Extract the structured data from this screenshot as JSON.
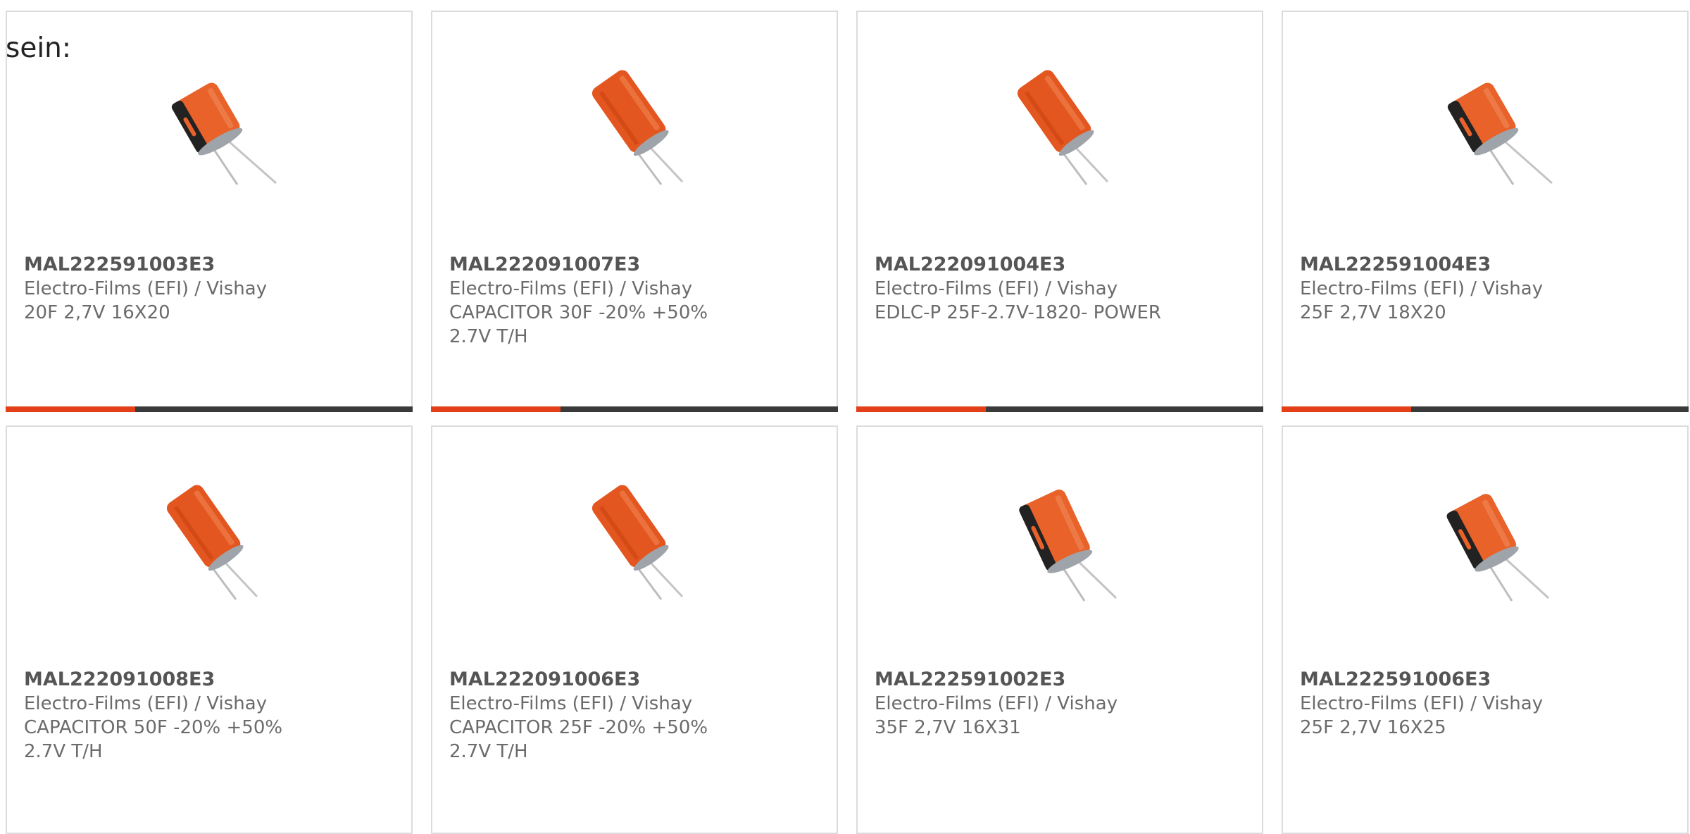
{
  "intro_text": "sein:",
  "colors": {
    "accent": "#e3401a",
    "bar_dark": "#3a3a3a",
    "capacitor_orange": "#e8622a"
  },
  "products": [
    {
      "part_number": "MAL222591003E3",
      "manufacturer": "Electro-Films (EFI) / Vishay",
      "description": "20F 2,7V 16X20",
      "image_icon": "capacitor-image"
    },
    {
      "part_number": "MAL222091007E3",
      "manufacturer": "Electro-Films (EFI) / Vishay",
      "description": "CAPACITOR 30F -20% +50%\n2.7V T/H",
      "image_icon": "capacitor-image"
    },
    {
      "part_number": "MAL222091004E3",
      "manufacturer": "Electro-Films (EFI) / Vishay",
      "description": "EDLC-P 25F-2.7V-1820- POWER",
      "image_icon": "capacitor-image"
    },
    {
      "part_number": "MAL222591004E3",
      "manufacturer": "Electro-Films (EFI) / Vishay",
      "description": "25F 2,7V 18X20",
      "image_icon": "capacitor-image"
    },
    {
      "part_number": "MAL222091008E3",
      "manufacturer": "Electro-Films (EFI) / Vishay",
      "description": "CAPACITOR 50F -20% +50%\n2.7V T/H",
      "image_icon": "capacitor-image"
    },
    {
      "part_number": "MAL222091006E3",
      "manufacturer": "Electro-Films (EFI) / Vishay",
      "description": "CAPACITOR 25F -20% +50%\n2.7V T/H",
      "image_icon": "capacitor-image"
    },
    {
      "part_number": "MAL222591002E3",
      "manufacturer": "Electro-Films (EFI) / Vishay",
      "description": "35F 2,7V 16X31",
      "image_icon": "capacitor-image"
    },
    {
      "part_number": "MAL222591006E3",
      "manufacturer": "Electro-Films (EFI) / Vishay",
      "description": "25F 2,7V 16X25",
      "image_icon": "capacitor-image"
    }
  ]
}
